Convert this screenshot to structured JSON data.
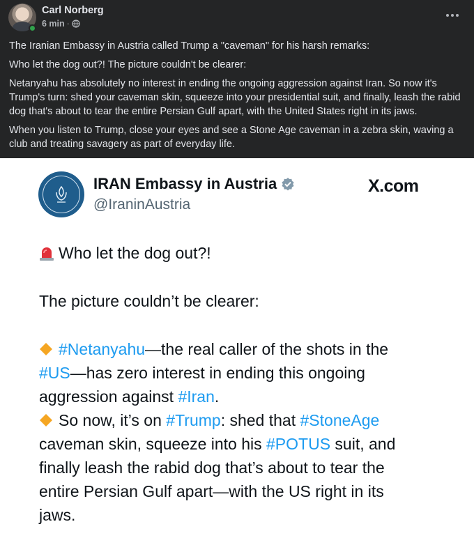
{
  "post": {
    "author": "Carl Norberg",
    "time": "6 min",
    "separator": "·",
    "paragraphs": [
      "The Iranian Embassy in Austria called Trump a \"caveman\" for his harsh remarks:",
      "Who let the dog out?! The picture couldn't be clearer:",
      "Netanyahu has absolutely no interest in ending the ongoing aggression against Iran. So now it's Trump's turn: shed your caveman skin, squeeze into your presidential suit, and finally, leash the rabid dog that's about to tear the entire Persian Gulf apart, with the United States right in its jaws.",
      "When you listen to Trump, close your eyes and see a Stone Age caveman in a zebra skin, waving a club and treating savagery as part of everyday life."
    ]
  },
  "tweet": {
    "account_name": "IRAN Embassy in Austria",
    "handle": "@IraninAustria",
    "source": "X.com",
    "line1": "Who let the dog out?!",
    "line2": "The picture couldn’t be clearer:",
    "p3_l1_tag": "#Netanyahu",
    "p3_l1_rest": "—the real caller of the shots in the",
    "p3_l2_tag": "#US",
    "p3_l2_rest": "—has zero interest in ending this ongoing",
    "p3_l3_text": "aggression against ",
    "p3_l3_tag": "#Iran",
    "p3_l3_end": ".",
    "p4_l1_text": "So now, it’s on ",
    "p4_l1_tag1": "#Trump",
    "p4_l1_mid": ": shed that ",
    "p4_l1_tag2": "#StoneAge",
    "p4_l2_text": "caveman skin, squeeze into his ",
    "p4_l2_tag": "#POTUS",
    "p4_l2_end": " suit, and",
    "p4_l3": "finally leash the rabid dog that’s about to tear the",
    "p4_l4": "entire Persian Gulf apart—with the US right in its",
    "p4_l5": "jaws."
  },
  "colors": {
    "background": "#242526",
    "text": "#e4e6eb",
    "hashtag": "#1d9bf0",
    "online": "#31a24c"
  },
  "icons": [
    "globe-icon",
    "more-options-icon",
    "verified-badge-icon",
    "siren-emoji-icon",
    "orange-diamond-emoji-icon",
    "embassy-logo"
  ]
}
